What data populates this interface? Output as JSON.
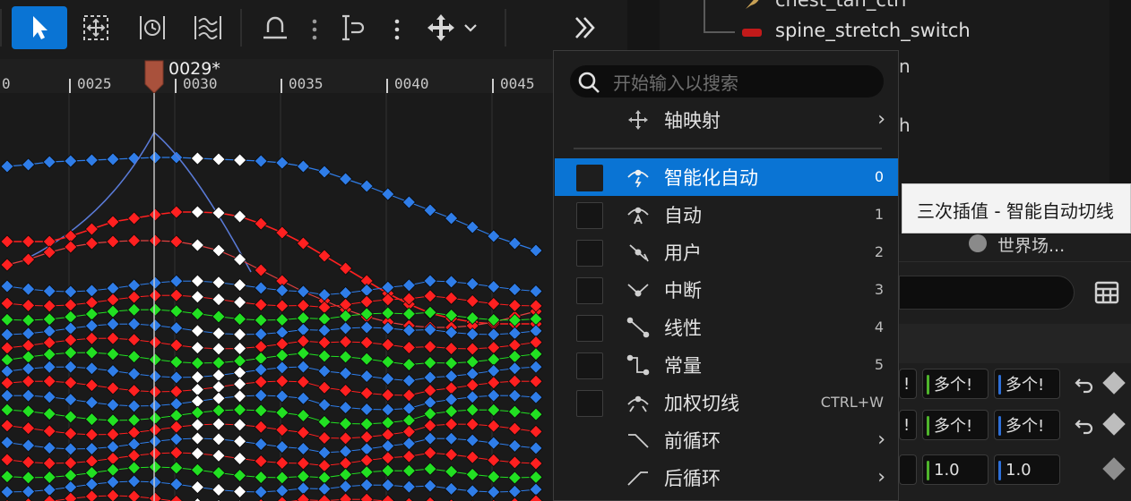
{
  "toolbar": {
    "buttons": [
      "select",
      "transform",
      "retime",
      "normalize",
      "flatten",
      "tangents",
      "axis-move"
    ]
  },
  "timeline": {
    "ticks": [
      "0",
      "0025",
      "0030",
      "0035",
      "0040",
      "0045"
    ],
    "current_frame": "0029*"
  },
  "outliner": {
    "items": [
      {
        "label": "chest_tan_ctrl",
        "icon": "feather-icon"
      },
      {
        "label": "spine_stretch_switch",
        "icon": "red-bar-icon"
      }
    ],
    "partial": [
      "n",
      "h"
    ]
  },
  "details": {
    "world_label": "世界场...",
    "rows": [
      {
        "values": [
          "多个!",
          "多个!"
        ]
      },
      {
        "values": [
          "多个!",
          "多个!"
        ]
      },
      {
        "values": [
          "1.0",
          "1.0"
        ]
      }
    ]
  },
  "menu": {
    "search_placeholder": "开始输入以搜索",
    "axis_mapping": "轴映射",
    "items": [
      {
        "label": "智能化自动",
        "key": "0",
        "selected": true,
        "icon": "smart-auto-tangent-icon"
      },
      {
        "label": "自动",
        "key": "1",
        "icon": "auto-tangent-icon"
      },
      {
        "label": "用户",
        "key": "2",
        "icon": "user-tangent-icon"
      },
      {
        "label": "中断",
        "key": "3",
        "icon": "break-tangent-icon"
      },
      {
        "label": "线性",
        "key": "4",
        "icon": "linear-tangent-icon"
      },
      {
        "label": "常量",
        "key": "5",
        "icon": "constant-tangent-icon"
      },
      {
        "label": "加权切线",
        "key": "CTRL+W",
        "icon": "weighted-tangent-icon"
      }
    ],
    "pre_infinity": "前循环",
    "post_infinity": "后循环"
  },
  "tooltip": "三次插值 - 智能自动切线",
  "colors": {
    "accent": "#0a74d4",
    "red": "#ff2020",
    "blue": "#2f7de8",
    "green": "#22e022"
  }
}
